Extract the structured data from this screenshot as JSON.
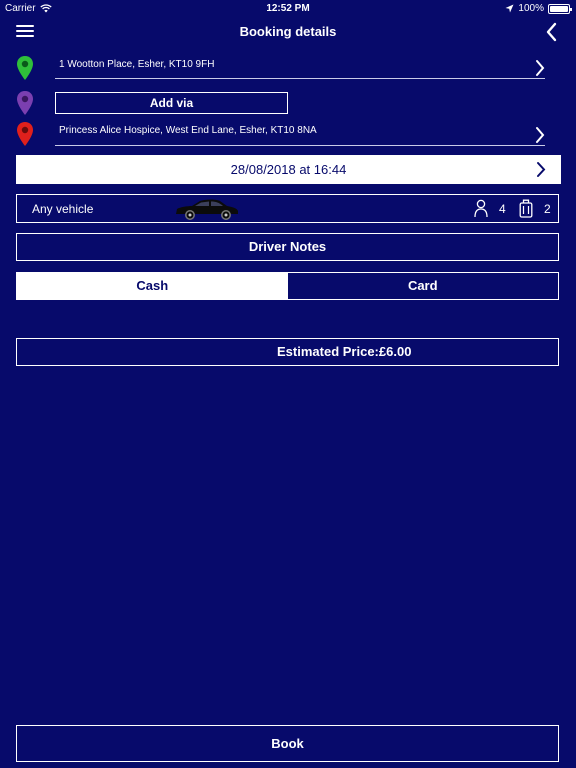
{
  "status_bar": {
    "carrier": "Carrier",
    "time": "12:52 PM",
    "battery": "100%",
    "icons": [
      "wifi-icon",
      "location-arrow-icon",
      "battery-icon"
    ]
  },
  "header": {
    "title": "Booking details",
    "menu_icon": "hamburger-icon",
    "back_icon": "chevron-left-icon"
  },
  "pickup": {
    "address": "1 Wootton Place, Esher, KT10 9FH",
    "pin_color": "#2fbf3a"
  },
  "via": {
    "label": "Add via",
    "pin_color": "#7b3fb0"
  },
  "dropoff": {
    "address": "Princess Alice Hospice, West End Lane, Esher, KT10 8NA",
    "pin_color": "#e0201c"
  },
  "datetime": "28/08/2018 at 16:44",
  "vehicle": {
    "name": "Any vehicle",
    "passengers": "4",
    "luggage": "2"
  },
  "driver_notes": "Driver Notes",
  "payment": {
    "options": [
      "Cash",
      "Card"
    ],
    "selected": "Cash"
  },
  "price": {
    "label": "Estimated Price",
    "separator": ":",
    "value": "£6.00"
  },
  "book_label": "Book",
  "colors": {
    "background": "#070a6b",
    "foreground": "#ffffff"
  }
}
